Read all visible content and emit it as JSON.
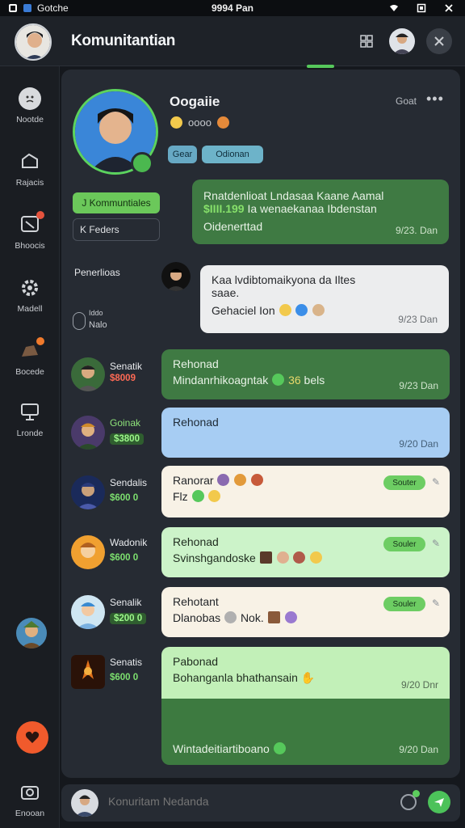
{
  "status_bar": {
    "app": "Gotche",
    "carrier": "9994 Pan"
  },
  "header": {
    "title": "Komunitantian"
  },
  "sidebar": {
    "items": [
      {
        "label": "Nootde",
        "icon": "face-icon"
      },
      {
        "label": "Rajacis",
        "icon": "shield-icon"
      },
      {
        "label": "Bhoocis",
        "icon": "chat-icon"
      },
      {
        "label": "Madell",
        "icon": "gear-icon"
      },
      {
        "label": "Bocede",
        "icon": "rock-icon"
      },
      {
        "label": "Lronde",
        "icon": "monitor-icon"
      },
      {
        "label": "Enooan",
        "icon": "camera-icon"
      }
    ]
  },
  "profile": {
    "name": "Oogaiie",
    "subtitle": "oooo",
    "menu_label": "Goat",
    "tags": [
      "Gear",
      "Odionan"
    ],
    "primary_button": "J Kommuntiales",
    "secondary_button": "K Feders"
  },
  "messages": {
    "pinned": {
      "line1": "Rnatdenlioat Lndasaa Kaane Aamal",
      "amount": "$ІІІІ.199",
      "line2": " Ia wenaekanaa Ibdenstan",
      "line3": "Oidenerttad",
      "time": "9/23. Dan"
    },
    "incoming": {
      "author": "Penerlioas",
      "line1": "Kaa lvdibtomaikyona da Iltes",
      "line2": "saae.",
      "line3": "Gehaciel Ion",
      "time": "9/23 Dan",
      "sidebar_label_top": "Iddo",
      "sidebar_label_bottom": "Nalo"
    },
    "list": [
      {
        "name": "Senatik",
        "amount": "$8009",
        "title": "Rehonad",
        "body": "Mindanrhikoagntak",
        "extra": "36",
        "extra2": "bels",
        "time": "9/23 Dan",
        "pill": ""
      },
      {
        "name": "Goinak",
        "amount": "$3800",
        "title": "Rehonad",
        "body": "",
        "time": "9/20 Dan",
        "pill": ""
      },
      {
        "name": "Sendalis",
        "amount": "$600 0",
        "title": "Ranorar",
        "body": "Flz",
        "time": "",
        "pill": "Souter"
      },
      {
        "name": "Wadonik",
        "amount": "$600 0",
        "title": "Rehonad",
        "body": "Svinshgandoske",
        "time": "",
        "pill": "Souler"
      },
      {
        "name": "Senalik",
        "amount": "$200 0",
        "title": "Rehotant",
        "body": "Dlanobas",
        "extra": "Nok.",
        "time": "",
        "pill": "Souler"
      },
      {
        "name": "Senatis",
        "amount": "$600 0",
        "title": "Pabonad",
        "body": "Bohanganla bhathansain",
        "time": "9/20 Dnr",
        "pill": ""
      }
    ],
    "last": {
      "body": "Wintadeitiartiboano",
      "time": "9/20 Dan"
    }
  },
  "input": {
    "placeholder": "Konuritam Nedanda"
  },
  "colors": {
    "accent_green": "#4cc25a",
    "bg": "#15181d",
    "fab": "#f05a2c"
  }
}
